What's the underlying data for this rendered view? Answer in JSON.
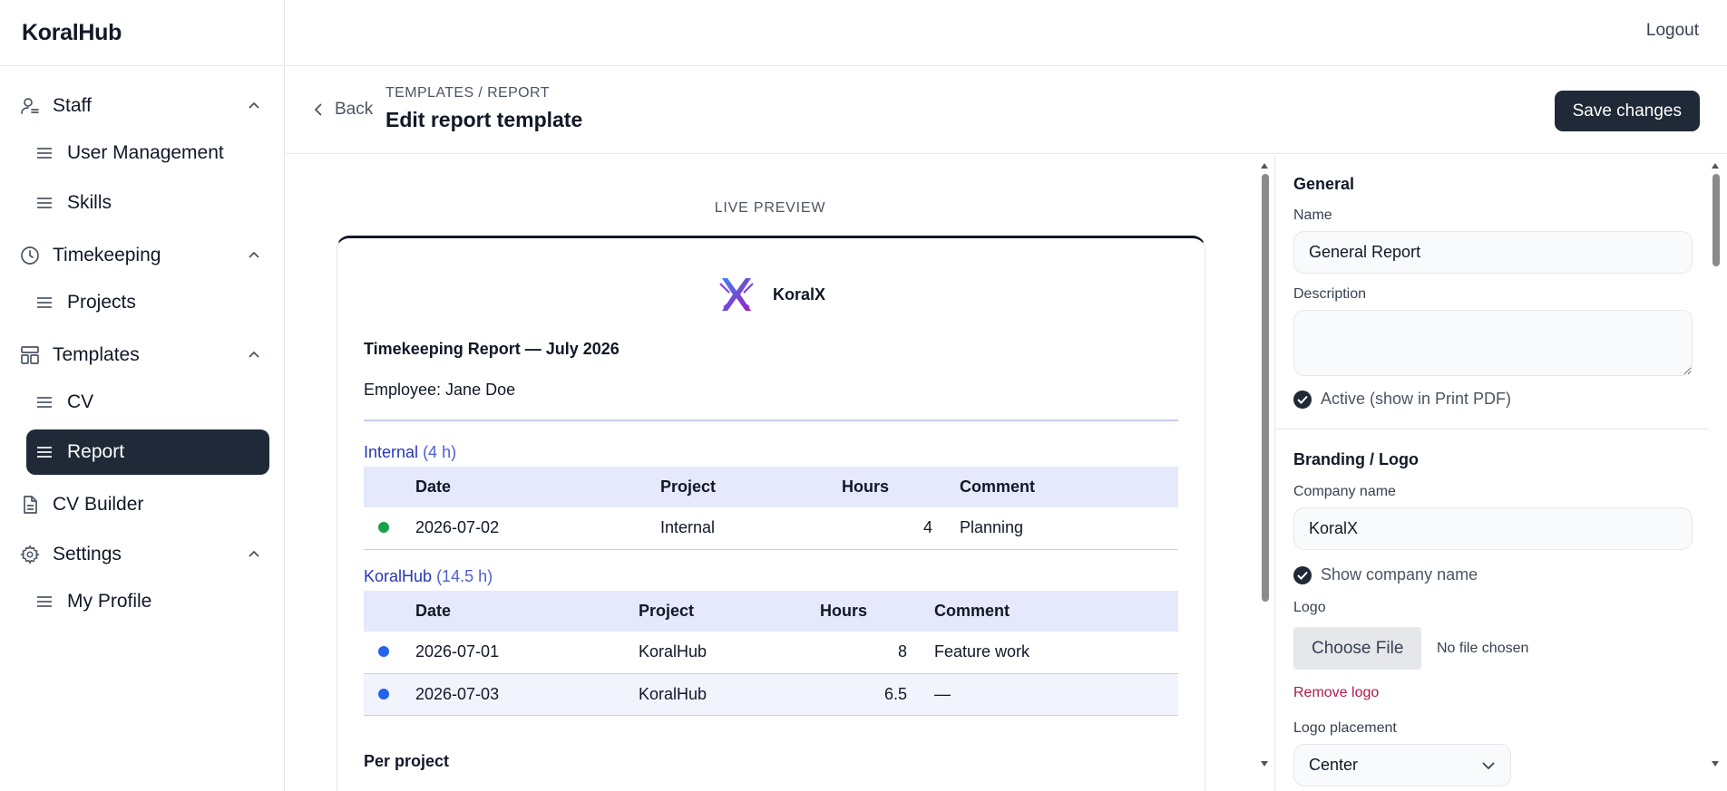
{
  "app": {
    "brand": "KoralHub",
    "logout_label": "Logout"
  },
  "sidebar": {
    "groups": [
      {
        "label": "Staff",
        "icon": "user-icon",
        "items": [
          "User Management",
          "Skills"
        ]
      },
      {
        "label": "Timekeeping",
        "icon": "clock-icon",
        "items": [
          "Projects"
        ]
      },
      {
        "label": "Templates",
        "icon": "layout-icon",
        "items": [
          "CV",
          "Report"
        ]
      },
      {
        "label": "CV Builder",
        "icon": "document-icon",
        "items": []
      },
      {
        "label": "Settings",
        "icon": "gear-icon",
        "items": [
          "My Profile"
        ]
      }
    ],
    "active_item": "Report"
  },
  "header": {
    "back_label": "Back",
    "breadcrumb": "TEMPLATES / REPORT",
    "title": "Edit report template",
    "save_label": "Save changes"
  },
  "preview": {
    "label": "LIVE PREVIEW",
    "company": "KoralX",
    "report_title": "Timekeeping Report — July 2026",
    "employee": "Employee: Jane Doe",
    "columns": [
      "Date",
      "Project",
      "Hours",
      "Comment"
    ],
    "sections": [
      {
        "name": "Internal",
        "hours": "(4 h)",
        "dot_color": "#16a34a",
        "rows": [
          {
            "date": "2026-07-02",
            "project": "Internal",
            "hours": "4",
            "comment": "Planning"
          }
        ]
      },
      {
        "name": "KoralHub",
        "hours": "(14.5 h)",
        "dot_color": "#2563eb",
        "rows": [
          {
            "date": "2026-07-01",
            "project": "KoralHub",
            "hours": "8",
            "comment": "Feature work"
          },
          {
            "date": "2026-07-03",
            "project": "KoralHub",
            "hours": "6.5",
            "comment": "—"
          }
        ]
      }
    ],
    "per_project_heading": "Per project"
  },
  "settings": {
    "general": {
      "title": "General",
      "name_label": "Name",
      "name_value": "General Report",
      "description_label": "Description",
      "description_value": "",
      "active_label": "Active (show in Print PDF)"
    },
    "branding": {
      "title": "Branding / Logo",
      "company_label": "Company name",
      "company_value": "KoralX",
      "show_company_label": "Show company name",
      "logo_label": "Logo",
      "choose_file_label": "Choose File",
      "no_file_label": "No file chosen",
      "remove_logo_label": "Remove logo",
      "placement_label": "Logo placement",
      "placement_value": "Center"
    }
  },
  "colors": {
    "primary_dark": "#1f2937",
    "section_blue": "#2536b8",
    "header_row": "#e5e9fb",
    "danger": "#b3194a"
  }
}
